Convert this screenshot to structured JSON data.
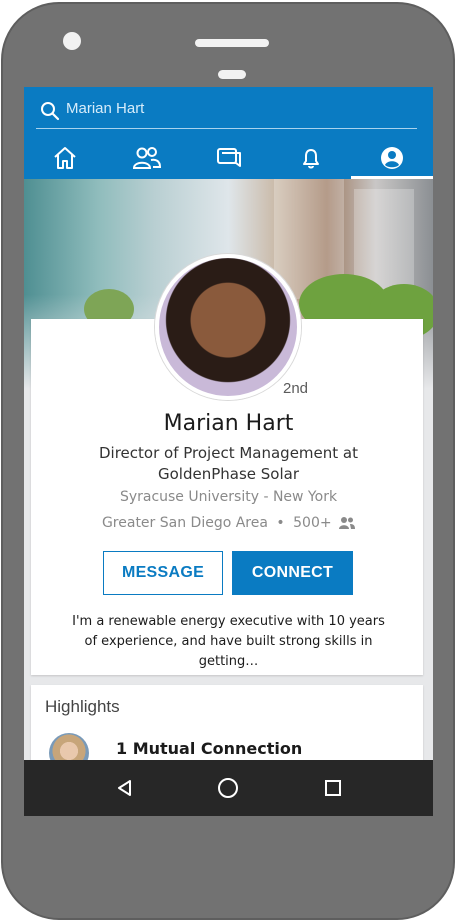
{
  "search": {
    "value": "Marian Hart"
  },
  "nav": {
    "items": [
      {
        "icon": "home-icon"
      },
      {
        "icon": "network-icon"
      },
      {
        "icon": "messaging-icon"
      },
      {
        "icon": "notifications-icon"
      },
      {
        "icon": "profile-icon",
        "active": true
      }
    ]
  },
  "profile": {
    "degree": "2nd",
    "name": "Marian Hart",
    "headline": "Director of Project Management at GoldenPhase Solar",
    "education": "Syracuse University - New York",
    "location": "Greater San Diego Area",
    "separator": "•",
    "connections": "500+",
    "message_label": "MESSAGE",
    "connect_label": "CONNECT",
    "summary": "I'm a renewable energy executive with 10 years of experience, and have built strong skills in getting…"
  },
  "highlights": {
    "title": "Highlights",
    "mutual": "1 Mutual Connection"
  },
  "colors": {
    "brand": "#0a7bc2",
    "system_nav": "#272727"
  }
}
